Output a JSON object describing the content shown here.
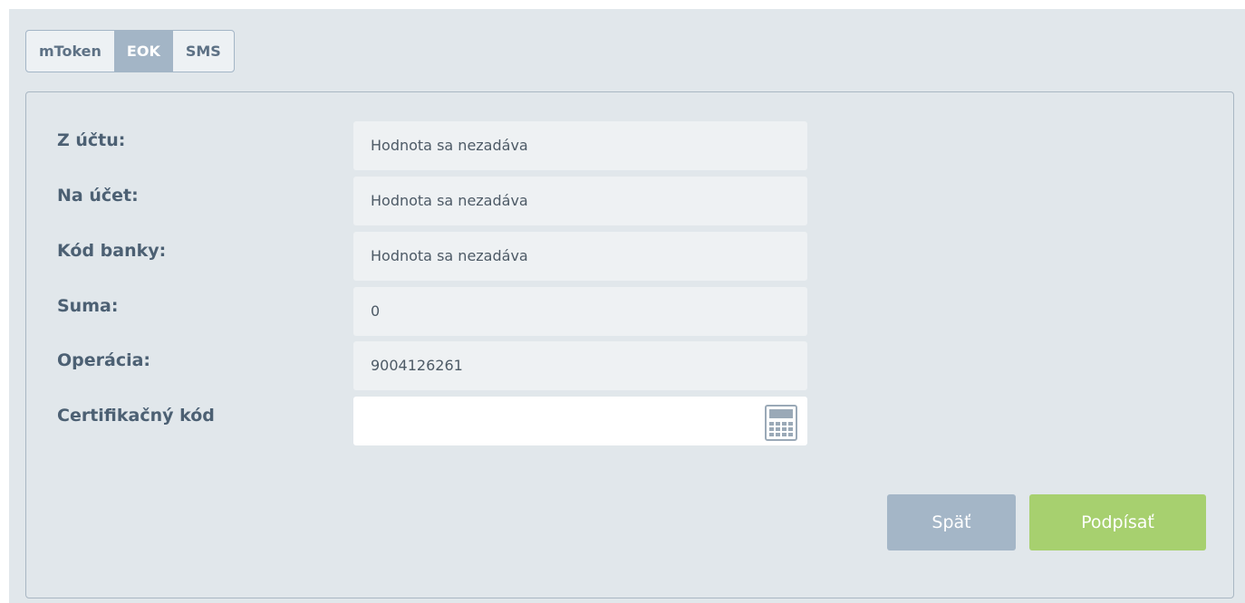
{
  "tabs": [
    {
      "label": "mToken",
      "active": false
    },
    {
      "label": "EOK",
      "active": true
    },
    {
      "label": "SMS",
      "active": false
    }
  ],
  "form": {
    "rows": [
      {
        "label": "Z účtu:",
        "value": "Hodnota sa nezadáva"
      },
      {
        "label": "Na účet:",
        "value": "Hodnota sa nezadáva"
      },
      {
        "label": "Kód banky:",
        "value": "Hodnota sa nezadáva"
      },
      {
        "label": "Suma:",
        "value": "0"
      },
      {
        "label": "Operácia:",
        "value": "9004126261"
      },
      {
        "label": "Certifikačný kód",
        "value": ""
      }
    ],
    "certificate_icon": "calculator-icon"
  },
  "buttons": {
    "back_label": "Späť",
    "sign_label": "Podpísať"
  },
  "colors": {
    "background": "#e1e7eb",
    "tab_active": "#a3b5c6",
    "button_back": "#a4b6c7",
    "button_sign": "#a7d06f",
    "label_text": "#4c6073"
  }
}
